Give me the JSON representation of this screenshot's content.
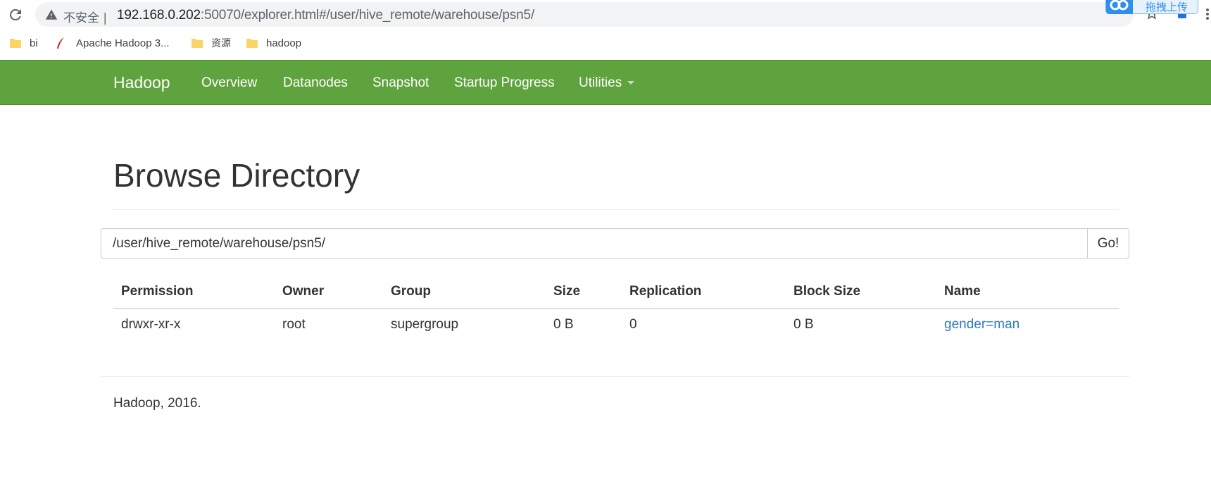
{
  "browser": {
    "security_label": "不安全",
    "separator": "|",
    "url_host": "192.168.0.202",
    "url_rest": ":50070/explorer.html#/user/hive_remote/warehouse/psn5/",
    "upload_widget_label": "拖拽上传",
    "bookmarks": [
      {
        "label": "bi",
        "icon": "folder-icon"
      },
      {
        "label": "Apache Hadoop 3...",
        "icon": "feather-icon"
      },
      {
        "label": "资源",
        "icon": "folder-icon"
      },
      {
        "label": "hadoop",
        "icon": "folder-icon"
      }
    ]
  },
  "navbar": {
    "brand": "Hadoop",
    "items": [
      "Overview",
      "Datanodes",
      "Snapshot",
      "Startup Progress",
      "Utilities"
    ],
    "color": "#5fa33e"
  },
  "main": {
    "title": "Browse Directory",
    "path_value": "/user/hive_remote/warehouse/psn5/",
    "go_label": "Go!",
    "table": {
      "headers": [
        "Permission",
        "Owner",
        "Group",
        "Size",
        "Replication",
        "Block Size",
        "Name"
      ],
      "rows": [
        [
          "drwxr-xr-x",
          "root",
          "supergroup",
          "0 B",
          "0",
          "0 B",
          "gender=man"
        ]
      ]
    },
    "link_color": "#337ab7"
  },
  "footer": {
    "text": "Hadoop, 2016."
  }
}
